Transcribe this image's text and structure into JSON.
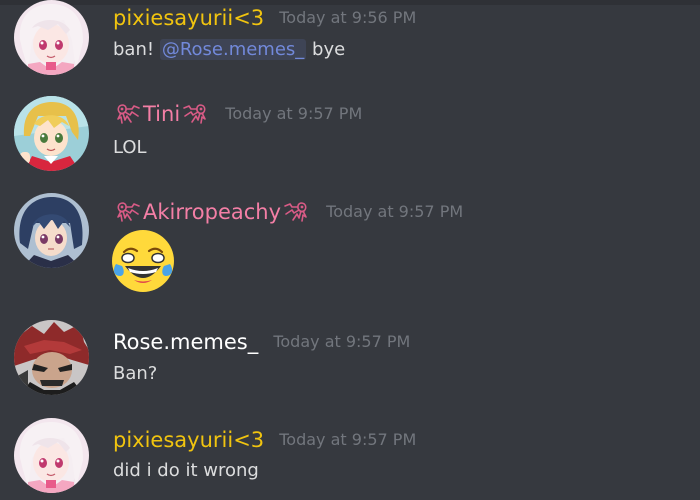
{
  "colors": {
    "background": "#36393f",
    "name_yellow": "#f1c40f",
    "name_pink": "#f47fa6",
    "name_white": "#ffffff",
    "mention": "#7289da",
    "timestamp": "#72767d",
    "text": "#dcddde"
  },
  "messages": [
    {
      "username": "pixiesayurii<3",
      "timestamp": "Today at 9:56 PM",
      "text_before": "ban! ",
      "mention": "@Rose.memes_",
      "text_after": " bye",
      "avatar_icon": "anime-girl-pink-avatar"
    },
    {
      "username": "Tini",
      "name_icon": "squid-icon",
      "timestamp": "Today at 9:57 PM",
      "text": "LOL",
      "avatar_icon": "anime-girl-blonde-avatar"
    },
    {
      "username": "Akirropeachy",
      "name_icon": "squid-icon",
      "timestamp": "Today at 9:57 PM",
      "emoji": "joy-emoji",
      "avatar_icon": "anime-girl-blue-hair-avatar"
    },
    {
      "username": "Rose.memes_",
      "timestamp": "Today at 9:57 PM",
      "text": "Ban?",
      "avatar_icon": "anime-boy-red-hair-avatar"
    },
    {
      "username": "pixiesayurii<3",
      "timestamp": "Today at 9:57 PM",
      "text": "did i do it wrong",
      "avatar_icon": "anime-girl-pink-avatar"
    }
  ]
}
